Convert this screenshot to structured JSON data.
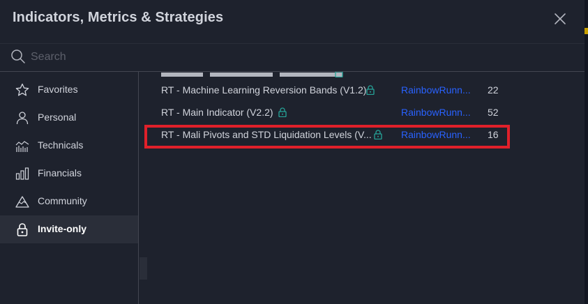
{
  "header": {
    "title": "Indicators, Metrics & Strategies",
    "close_icon": "close-icon"
  },
  "search": {
    "placeholder": "Search",
    "value": "",
    "icon": "search-icon"
  },
  "sidebar": {
    "items": [
      {
        "label": "Favorites",
        "icon": "star-icon",
        "active": false
      },
      {
        "label": "Personal",
        "icon": "person-icon",
        "active": false
      },
      {
        "label": "Technicals",
        "icon": "chart-icon",
        "active": false
      },
      {
        "label": "Financials",
        "icon": "bar-chart-icon",
        "active": false
      },
      {
        "label": "Community",
        "icon": "mountain-icon",
        "active": false
      },
      {
        "label": "Invite-only",
        "icon": "lock-icon",
        "active": true
      }
    ]
  },
  "list": {
    "rows": [
      {
        "name": "RT - Machine Learning Reversion Bands (V1.2)",
        "author": "RainbowRunn...",
        "count": "22"
      },
      {
        "name": "RT - Main Indicator (V2.2)",
        "author": "RainbowRunn...",
        "count": "52"
      },
      {
        "name": "RT - Mali Pivots and STD Liquidation Levels (V...",
        "author": "RainbowRunn...",
        "count": "16"
      }
    ]
  },
  "colors": {
    "background": "#1e222d",
    "text": "#d1d4dc",
    "author_link": "#2962ff",
    "lock": "#26a69a",
    "highlight": "#e0202a"
  }
}
